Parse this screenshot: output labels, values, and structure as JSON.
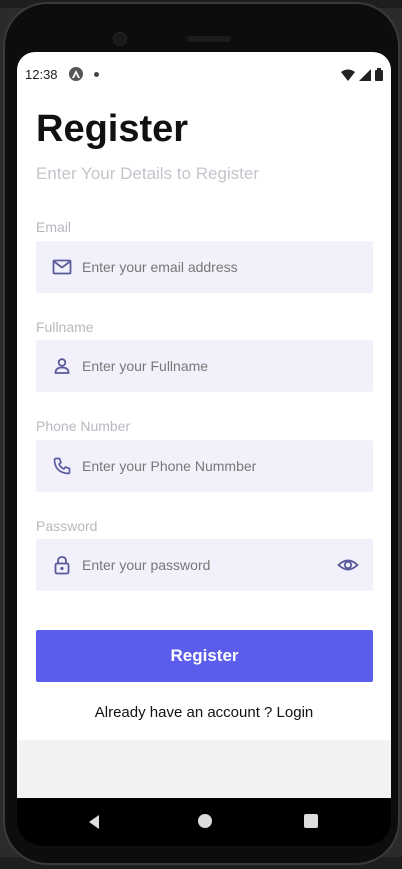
{
  "status": {
    "time": "12:38"
  },
  "header": {
    "title": "Register",
    "subtitle": "Enter Your Details to Register"
  },
  "form": {
    "email": {
      "label": "Email",
      "placeholder": "Enter your email address",
      "value": "",
      "icon": "mail-icon"
    },
    "fullname": {
      "label": "Fullname",
      "placeholder": "Enter your Fullname",
      "value": "",
      "icon": "person-icon"
    },
    "phone": {
      "label": "Phone Number",
      "placeholder": "Enter your Phone Nummber",
      "value": "",
      "icon": "phone-icon"
    },
    "password": {
      "label": "Password",
      "placeholder": "Enter your password",
      "value": "",
      "icon": "lock-icon",
      "toggle_icon": "eye-icon"
    },
    "submit_label": "Register"
  },
  "footer": {
    "login_prompt": "Already have an account ? Login"
  },
  "colors": {
    "accent": "#5b5ceb",
    "field_bg": "#f2f1fb",
    "icon": "#5a5a9a"
  }
}
